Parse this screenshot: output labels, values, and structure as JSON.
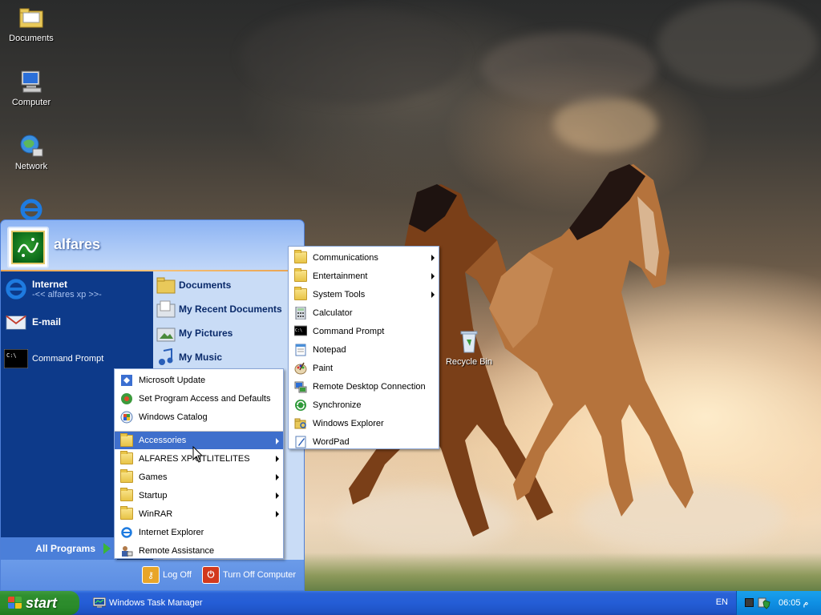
{
  "desktop": {
    "icons": [
      {
        "label": "Documents"
      },
      {
        "label": "Computer"
      },
      {
        "label": "Network"
      },
      {
        "label": "Recycle Bin"
      }
    ]
  },
  "start_menu": {
    "username": "alfares",
    "left_items": [
      {
        "title": "Internet",
        "subtitle": "-<< alfares xp >>-"
      },
      {
        "title": "E-mail"
      },
      {
        "title": "Command Prompt"
      }
    ],
    "right_items": [
      {
        "label": "Documents"
      },
      {
        "label": "My Recent Documents"
      },
      {
        "label": "My Pictures"
      },
      {
        "label": "My Music"
      }
    ],
    "all_programs_label": "All Programs",
    "log_off_label": "Log Off",
    "turn_off_label": "Turn Off Computer"
  },
  "programs_menu": {
    "items": [
      {
        "label": "Microsoft Update",
        "submenu": false
      },
      {
        "label": "Set Program Access and Defaults",
        "submenu": false
      },
      {
        "label": "Windows Catalog",
        "submenu": false
      },
      {
        "label": "Accessories",
        "submenu": true,
        "highlighted": true
      },
      {
        "label": "ALFARES XP UTLITELITES",
        "submenu": true
      },
      {
        "label": "Games",
        "submenu": true
      },
      {
        "label": "Startup",
        "submenu": true
      },
      {
        "label": "WinRAR",
        "submenu": true
      },
      {
        "label": "Internet Explorer",
        "submenu": false
      },
      {
        "label": "Remote Assistance",
        "submenu": false
      }
    ]
  },
  "accessories_menu": {
    "items": [
      {
        "label": "Communications",
        "submenu": true
      },
      {
        "label": "Entertainment",
        "submenu": true
      },
      {
        "label": "System Tools",
        "submenu": true
      },
      {
        "label": "Calculator",
        "submenu": false
      },
      {
        "label": "Command Prompt",
        "submenu": false
      },
      {
        "label": "Notepad",
        "submenu": false
      },
      {
        "label": "Paint",
        "submenu": false
      },
      {
        "label": "Remote Desktop Connection",
        "submenu": false
      },
      {
        "label": "Synchronize",
        "submenu": false
      },
      {
        "label": "Windows Explorer",
        "submenu": false
      },
      {
        "label": "WordPad",
        "submenu": false
      }
    ]
  },
  "taskbar": {
    "start_label": "start",
    "task_label": "Windows Task Manager",
    "language": "EN",
    "clock": "06:05 م"
  },
  "colors": {
    "taskbar_blue": "#245dd6",
    "start_green": "#2f8f2f",
    "menu_highlight": "#3f6fcc",
    "start_menu_left": "#0d3a8a",
    "start_menu_right": "#c9dcf6"
  }
}
